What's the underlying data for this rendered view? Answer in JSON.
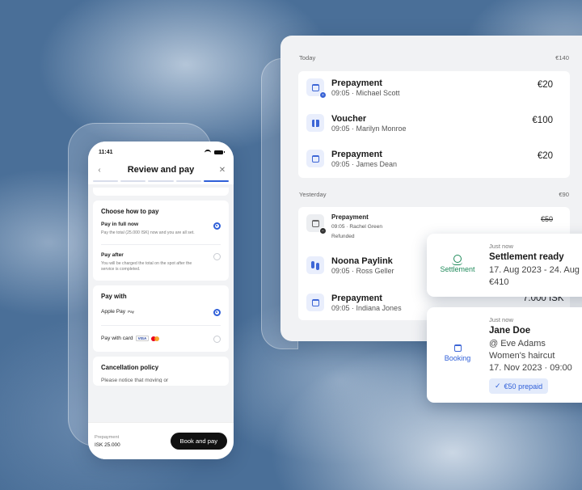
{
  "phone": {
    "status_time": "11:41",
    "title": "Review and pay",
    "back_icon": "chevron-left-icon",
    "close_icon": "close-icon",
    "choose": {
      "title": "Choose how to pay",
      "full_title": "Pay in full now",
      "full_desc": "Pay the total (25.000 ISK) now and you are all set.",
      "after_title": "Pay after",
      "after_desc": "You will be charged the total on the spot after the service is completed."
    },
    "pay_with": {
      "title": "Pay with",
      "apple_label": "Apple Pay",
      "apple_badge": "Pay",
      "card_label": "Pay with card",
      "visa": "VISA"
    },
    "cancel": {
      "title": "Cancellation policy",
      "body": "Please notice that moving or"
    },
    "footer": {
      "label": "Prepayment",
      "amount": "ISK 25.000",
      "button": "Book and pay"
    }
  },
  "panel": {
    "today": {
      "label": "Today",
      "total": "€140"
    },
    "yesterday": {
      "label": "Yesterday",
      "total": "€90"
    },
    "today_rows": [
      {
        "title": "Prepayment",
        "sub": "09:05 · Michael Scott",
        "amount": "€20",
        "icon": "calendar-icon"
      },
      {
        "title": "Voucher",
        "sub": "09:05 · Marilyn Monroe",
        "amount": "€100",
        "icon": "gift-icon"
      },
      {
        "title": "Prepayment",
        "sub": "09:05 · James Dean",
        "amount": "€20",
        "icon": "calendar-icon"
      }
    ],
    "yesterday_rows": [
      {
        "title": "Prepayment",
        "sub": "09:05 · Rachel Green",
        "note": "Refunded",
        "amount": "€50",
        "icon": "calendar-icon"
      },
      {
        "title": "Noona Paylink",
        "sub": "09:05 · Ross Geller",
        "amount": "",
        "icon": "paylink-icon"
      },
      {
        "title": "Prepayment",
        "sub": "09:05 · Indiana Jones",
        "amount": "",
        "icon": "calendar-icon"
      }
    ],
    "peek_amount": "7.000 ISK"
  },
  "settlement": {
    "side_label": "Settlement",
    "time": "Just now",
    "title": "Settlement ready",
    "range": "17. Aug 2023 - 24. Aug",
    "amount": "€410"
  },
  "booking": {
    "side_label": "Booking",
    "time": "Just now",
    "name": "Jane Doe",
    "staff": "@ Eve Adams",
    "service": "Women's haircut",
    "datetime": "17. Nov 2023 · 09:00",
    "prepaid": "€50 prepaid"
  },
  "colors": {
    "accent": "#2f5fd8",
    "settlement_green": "#1f8a5a",
    "background_sky": "#4a6f98"
  }
}
